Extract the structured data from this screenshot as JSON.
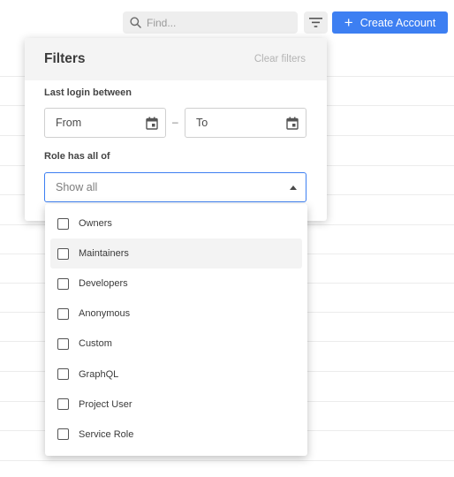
{
  "toolbar": {
    "search_placeholder": "Find...",
    "create_label": "Create Account",
    "create_icon": "plus-icon",
    "accent_color": "#3d7ff2"
  },
  "filters": {
    "title": "Filters",
    "clear_label": "Clear filters",
    "last_login_label": "Last login between",
    "from_placeholder": "From",
    "to_placeholder": "To",
    "role_label": "Role has all of",
    "role_value": "Show all"
  },
  "role_options": [
    {
      "label": "Owners",
      "checked": false
    },
    {
      "label": "Maintainers",
      "checked": false
    },
    {
      "label": "Developers",
      "checked": false
    },
    {
      "label": "Anonymous",
      "checked": false
    },
    {
      "label": "Custom",
      "checked": false
    },
    {
      "label": "GraphQL",
      "checked": false
    },
    {
      "label": "Project User",
      "checked": false
    },
    {
      "label": "Service Role",
      "checked": false
    }
  ]
}
